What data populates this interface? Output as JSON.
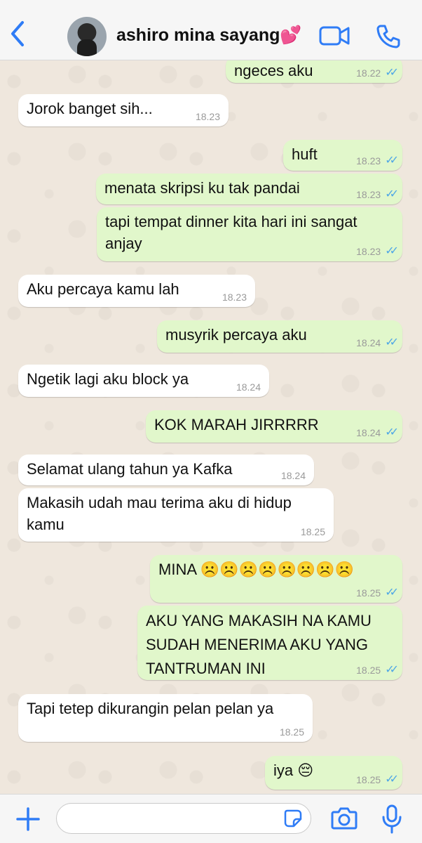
{
  "header": {
    "title": "ashiro mina sayang💕",
    "back_icon": "chevron-left-icon",
    "video_icon": "video-camera-icon",
    "call_icon": "phone-icon",
    "accent_color": "#2f7cf6"
  },
  "messages": [
    {
      "dir": "out",
      "text": "ngeces aku",
      "time": "18.22",
      "ticks": "✓✓"
    },
    {
      "dir": "in",
      "text": "Jorok banget sih...",
      "time": "18.23"
    },
    {
      "dir": "out",
      "text": "huft",
      "time": "18.23",
      "ticks": "✓✓"
    },
    {
      "dir": "out",
      "text": "menata skripsi ku tak pandai",
      "time": "18.23",
      "ticks": "✓✓"
    },
    {
      "dir": "out",
      "text": "tapi tempat dinner kita hari ini sangat anjay",
      "time": "18.23",
      "ticks": "✓✓"
    },
    {
      "dir": "in",
      "text": "Aku percaya kamu lah",
      "time": "18.23"
    },
    {
      "dir": "out",
      "text": "musyrik percaya aku",
      "time": "18.24",
      "ticks": "✓✓"
    },
    {
      "dir": "in",
      "text": "Ngetik lagi aku block ya",
      "time": "18.24"
    },
    {
      "dir": "out",
      "text": "KOK MARAH JIRRRRR",
      "time": "18.24",
      "ticks": "✓✓"
    },
    {
      "dir": "in",
      "text": "Selamat ulang tahun ya Kafka",
      "time": "18.24"
    },
    {
      "dir": "in",
      "text": "Makasih udah mau terima aku di hidup kamu",
      "time": "18.25"
    },
    {
      "dir": "out",
      "text": "MINA ☹️☹️☹️☹️☹️☹️☹️☹️",
      "time": "18.25",
      "ticks": "✓✓"
    },
    {
      "dir": "out",
      "text": "AKU YANG MAKASIH NA KAMU SUDAH MENERIMA AKU YANG TANTRUMAN INI",
      "time": "18.25",
      "ticks": "✓✓"
    },
    {
      "dir": "in",
      "text": "Tapi tetep dikurangin pelan pelan ya",
      "time": "18.25"
    },
    {
      "dir": "out",
      "text": "iya 😔",
      "time": "18.25",
      "ticks": "✓✓"
    }
  ],
  "composer": {
    "plus_icon": "plus-icon",
    "sticker_icon": "sticker-icon",
    "camera_icon": "camera-icon",
    "mic_icon": "microphone-icon",
    "placeholder": ""
  }
}
